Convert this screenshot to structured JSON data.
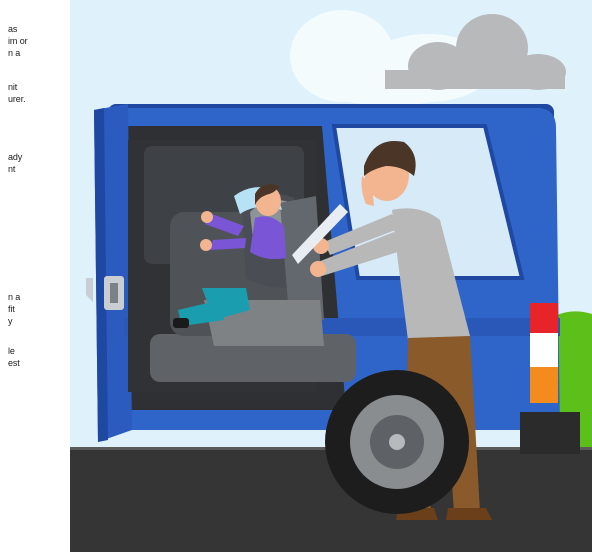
{
  "text_fragments": {
    "block1": [
      "as",
      "im or",
      "n a",
      "nit",
      "urer."
    ],
    "block2": [
      "ady",
      "nt"
    ],
    "block3": [
      "n a",
      "fit",
      "y",
      "le",
      "est"
    ]
  },
  "colors": {
    "sky": "#dff1fa",
    "cloud_white": "#f4fbfd",
    "cloud_gray": "#b7b9bb",
    "car_blue": "#2f64c9",
    "car_blue_dark": "#1f48a2",
    "interior_dark": "#2e3033",
    "seat_gray": "#7e8285",
    "road": "#353535",
    "road_edge": "#5a5a5a",
    "green_accent": "#63d21a",
    "yellow_accent": "#f2d21a",
    "shirt_gray": "#b8b8b8",
    "pants_brown": "#8a5a2b",
    "skin": "#f2b58f",
    "hair": "#4a3527",
    "child_shirt": "#7a56d6",
    "child_pants": "#1b9db0",
    "taillight_red": "#e6242a",
    "taillight_orange": "#f38b1e"
  }
}
